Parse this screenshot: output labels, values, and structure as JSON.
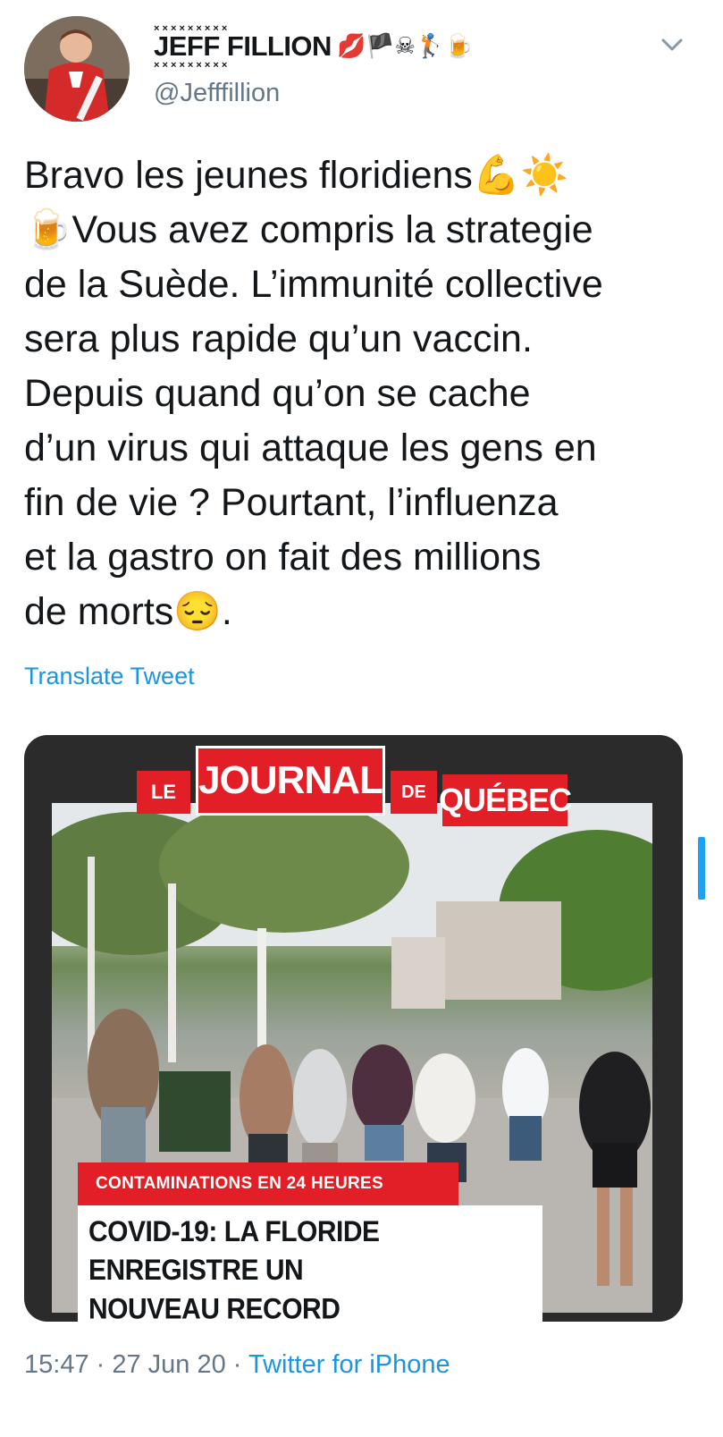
{
  "author": {
    "name": "JEFF FILLION",
    "name_emojis": "💋🏴☠🏌🍺",
    "handle": "@Jefffillion"
  },
  "tweet": {
    "text": "Bravo les jeunes floridiens💪☀️\n🍺Vous avez compris la strategie\nde la Suède. L’immunité collective\nsera plus rapide qu’un vaccin.\nDepuis quand qu’on se cache\nd’un virus qui attaque les gens en\nfin de vie ? Pourtant, l’influenza\net la gastro on fait des millions\nde morts😔.",
    "translate_label": "Translate Tweet"
  },
  "media": {
    "logo": {
      "le": "LE",
      "journal": "JOURNAL",
      "de": "DE",
      "quebec": "QUÉBEC"
    },
    "kicker": "CONTAMINATIONS EN 24 HEURES",
    "headline": "COVID-19: LA FLORIDE ENREGISTRE UN\nNOUVEAU RECORD"
  },
  "meta": {
    "time": "15:47",
    "sep1": " · ",
    "date": "27 Jun 20",
    "sep2": " · ",
    "source": "Twitter for iPhone"
  },
  "colors": {
    "accent": "#1b95e0",
    "brand_red": "#e21e26",
    "secondary_text": "#657786"
  }
}
